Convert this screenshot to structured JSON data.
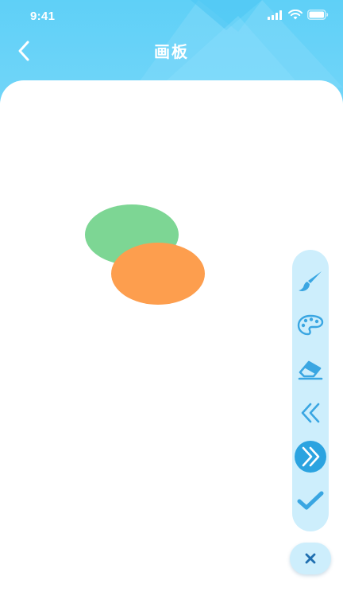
{
  "status_bar": {
    "time": "9:41"
  },
  "header": {
    "title": "画板",
    "back_icon": "chevron-left-icon"
  },
  "canvas": {
    "shapes": [
      {
        "type": "ellipse",
        "color": "#7dd694"
      },
      {
        "type": "ellipse",
        "color": "#fd9e4e"
      }
    ]
  },
  "toolbar": {
    "tools": [
      {
        "name": "brush",
        "icon": "brush-icon",
        "active": false
      },
      {
        "name": "palette",
        "icon": "palette-icon",
        "active": false
      },
      {
        "name": "eraser",
        "icon": "eraser-icon",
        "active": false
      },
      {
        "name": "undo",
        "icon": "double-chevron-left-icon",
        "active": false
      },
      {
        "name": "redo",
        "icon": "double-chevron-right-icon",
        "active": true
      },
      {
        "name": "confirm",
        "icon": "checkmark-icon",
        "active": false
      }
    ],
    "close_icon": "close-icon"
  },
  "colors": {
    "header": "#5fd0f7",
    "accent": "#2ba3e0",
    "toolbar_bg": "#cdeefc",
    "icon": "#3aa6e2"
  }
}
